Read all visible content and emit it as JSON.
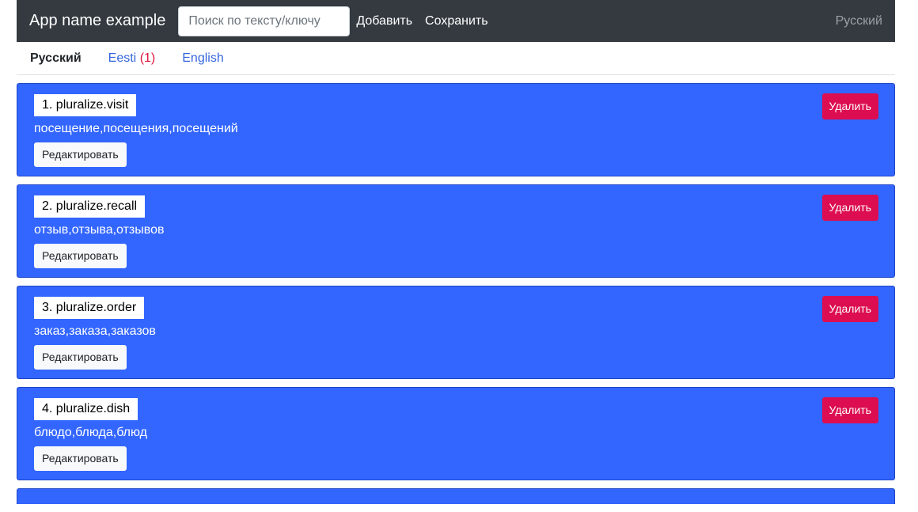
{
  "navbar": {
    "brand": "App name example",
    "search_placeholder": "Поиск по тексту/ключу",
    "add_label": "Добавить",
    "save_label": "Сохранить",
    "current_language": "Русский"
  },
  "tabs": [
    {
      "label": "Русский",
      "count": "",
      "active": true
    },
    {
      "label": "Eesti",
      "count": "(1)",
      "active": false
    },
    {
      "label": "English",
      "count": "",
      "active": false
    }
  ],
  "entries": [
    {
      "key": "1. pluralize.visit",
      "value": "посещение,посещения,посещений",
      "edit_label": "Редактировать",
      "delete_label": "Удалить"
    },
    {
      "key": "2. pluralize.recall",
      "value": "отзыв,отзыва,отзывов",
      "edit_label": "Редактировать",
      "delete_label": "Удалить"
    },
    {
      "key": "3. pluralize.order",
      "value": "заказ,заказа,заказов",
      "edit_label": "Редактировать",
      "delete_label": "Удалить"
    },
    {
      "key": "4. pluralize.dish",
      "value": "блюдо,блюда,блюд",
      "edit_label": "Редактировать",
      "delete_label": "Удалить"
    }
  ],
  "colors": {
    "navbar_bg": "#343a40",
    "card_bg": "#3366ff",
    "delete_bg": "#dc0d50",
    "tab_link": "#3366dd",
    "count_red": "#dc143c"
  }
}
